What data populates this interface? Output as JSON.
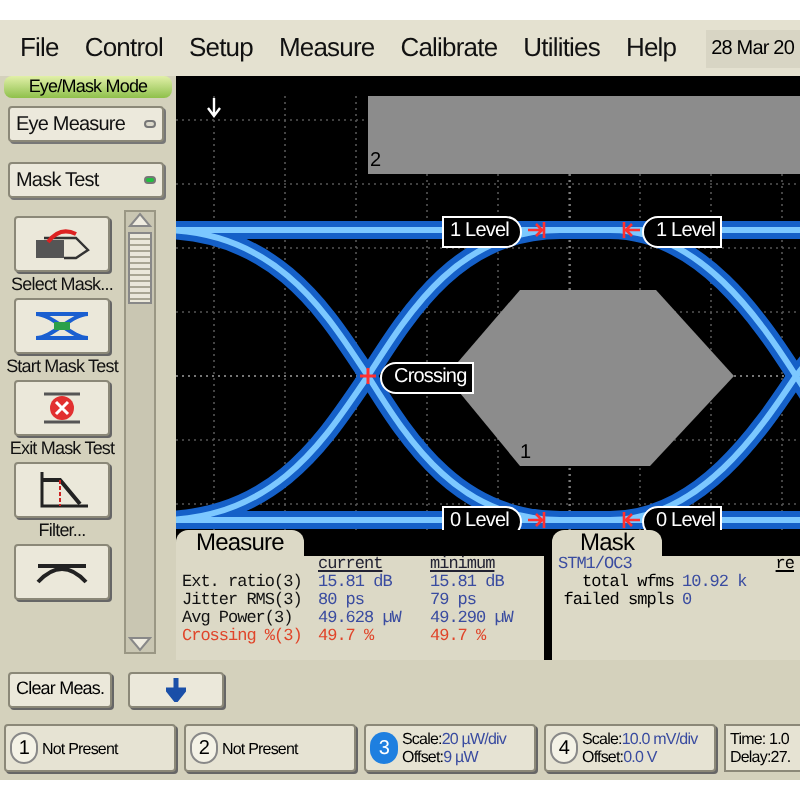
{
  "menu": [
    {
      "label": "File"
    },
    {
      "label": "Control"
    },
    {
      "label": "Setup"
    },
    {
      "label": "Measure"
    },
    {
      "label": "Calibrate"
    },
    {
      "label": "Utilities"
    },
    {
      "label": "Help"
    }
  ],
  "date": "28 Mar 20",
  "mode": {
    "title": "Eye/Mask Mode",
    "buttons": [
      {
        "label": "Eye Measure",
        "on": false
      },
      {
        "label": "Mask Test",
        "on": true
      }
    ]
  },
  "tools": [
    {
      "kind": "select_mask",
      "label": "Select Mask..."
    },
    {
      "kind": "start_mask",
      "label": "Start Mask Test"
    },
    {
      "kind": "exit_mask",
      "label": "Exit Mask Test"
    },
    {
      "kind": "filter",
      "label": "Filter..."
    },
    {
      "kind": "partial"
    }
  ],
  "scope": {
    "mask_markers": [
      "2",
      "1"
    ],
    "tags": [
      "1 Level",
      "1 Level",
      "Crossing",
      "0 Level",
      "0 Level"
    ]
  },
  "measure": {
    "tab": "Measure",
    "columns": [
      "current",
      "minimum"
    ],
    "rows": [
      {
        "name": "Ext. ratio(3)",
        "current": "15.81 dB",
        "minimum": "15.81 dB",
        "selected": false
      },
      {
        "name": "Jitter RMS(3)",
        "current": "80 ps",
        "minimum": "79 ps",
        "selected": false
      },
      {
        "name": "Avg Power(3)",
        "current": "49.628 µW",
        "minimum": "49.290 µW",
        "selected": false
      },
      {
        "name": "Crossing %(3)",
        "current": "49.7 %",
        "minimum": "49.7 %",
        "selected": true
      }
    ]
  },
  "mask": {
    "tab": "Mask",
    "name": "STM1/OC3",
    "column_3": "re",
    "rows": [
      {
        "label": "total wfms",
        "value": "10.92 k"
      },
      {
        "label": "failed smpls",
        "value": "0"
      }
    ]
  },
  "clear_button": "Clear Meas.",
  "channels": [
    {
      "number": "1",
      "selected": false,
      "lines": [
        {
          "label": "Not Present"
        }
      ]
    },
    {
      "number": "2",
      "selected": false,
      "lines": [
        {
          "label": "Not Present"
        }
      ]
    },
    {
      "number": "3",
      "selected": true,
      "lines": [
        {
          "label": "Scale:",
          "value": "20 µW/div"
        },
        {
          "label": "Offset:",
          "value": "9 µW"
        }
      ]
    },
    {
      "number": "4",
      "selected": false,
      "lines": [
        {
          "label": "Scale:",
          "value": "10.0 mV/div"
        },
        {
          "label": "Offset:",
          "value": "0.0 V"
        }
      ]
    }
  ],
  "timebase": [
    "Time: 1.0",
    "Delay:27."
  ]
}
